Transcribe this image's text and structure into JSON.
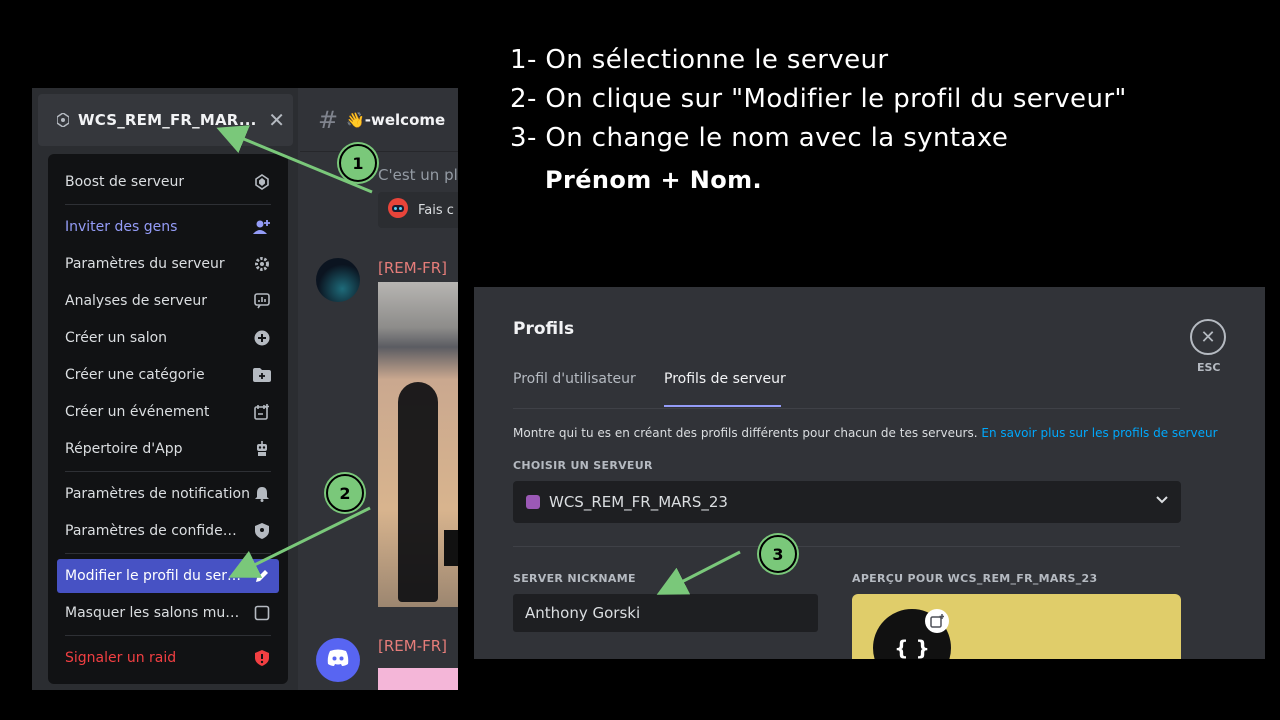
{
  "instructions": {
    "step1": "1- On sélectionne le serveur",
    "step2": "2- On clique sur \"Modifier le profil du serveur\"",
    "step3": "3- On change le nom avec la syntaxe",
    "syntax": "Prénom + Nom."
  },
  "discord": {
    "server_name": "WCS_REM_FR_MAR...",
    "close_glyph": "✕",
    "channel_hash": "#",
    "channel_name": "👋-welcome",
    "chat_snippet": "C'est un pla",
    "bot_text": "Fais c",
    "post_user_1": "[REM-FR]",
    "post_user_2": "[REM-FR]",
    "menu": [
      {
        "label": "Boost de serveur",
        "icon": "boost-icon",
        "style": "normal"
      },
      {
        "label": "Inviter des gens",
        "icon": "add-user-icon",
        "style": "blue"
      },
      {
        "label": "Paramètres du serveur",
        "icon": "gear-icon",
        "style": "normal"
      },
      {
        "label": "Analyses de serveur",
        "icon": "analytics-icon",
        "style": "normal"
      },
      {
        "label": "Créer un salon",
        "icon": "plus-circle-icon",
        "style": "normal"
      },
      {
        "label": "Créer une catégorie",
        "icon": "folder-plus-icon",
        "style": "normal"
      },
      {
        "label": "Créer un événement",
        "icon": "calendar-plus-icon",
        "style": "normal"
      },
      {
        "label": "Répertoire d'App",
        "icon": "robot-icon",
        "style": "normal"
      },
      {
        "label": "Paramètres de notification",
        "icon": "bell-icon",
        "style": "normal"
      },
      {
        "label": "Paramètres de confident...",
        "icon": "shield-icon",
        "style": "normal"
      },
      {
        "label": "Modifier le profil du serv...",
        "icon": "pencil-icon",
        "style": "active"
      },
      {
        "label": "Masquer les salons muets",
        "icon": "checkbox-icon",
        "style": "normal"
      },
      {
        "label": "Signaler un raid",
        "icon": "shield-alert-icon",
        "style": "red"
      }
    ]
  },
  "profiles": {
    "title": "Profils",
    "tabs": [
      "Profil d'utilisateur",
      "Profils de serveur"
    ],
    "esc_label": "ESC",
    "description": "Montre qui tu es en créant des profils différents pour chacun de tes serveurs. ",
    "description_link": "En savoir plus sur les profils de serveur",
    "choose_server_heading": "CHOISIR UN SERVEUR",
    "selected_server": "WCS_REM_FR_MARS_23",
    "nickname_heading": "SERVER NICKNAME",
    "nickname_value": "Anthony Gorski",
    "preview_heading": "APERÇU POUR WCS_REM_FR_MARS_23",
    "preview_avatar_text": "{ }"
  },
  "annotations": {
    "badge1": "1",
    "badge2": "2",
    "badge3": "3"
  },
  "colors": {
    "accent": "#4752c4",
    "annotation_green": "#7ac87a",
    "link": "#00a8fc",
    "danger": "#f23f42"
  }
}
